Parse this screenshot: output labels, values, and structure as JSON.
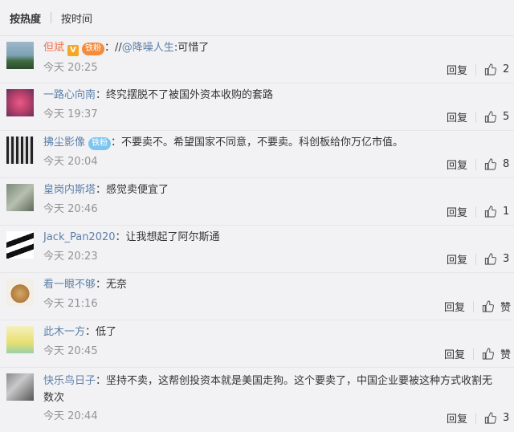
{
  "sort": {
    "hot": "按热度",
    "time": "按时间"
  },
  "comments": [
    {
      "user": "但斌",
      "v_badge": "V",
      "fan_badge": "铁粉",
      "fan_color": "orange",
      "text": "//@降噪人生:可惜了",
      "time": "今天 20:25",
      "reply": "回复",
      "likes": "2"
    },
    {
      "user": "一路心向南",
      "text": "终究摆脱不了被国外资本收购的套路",
      "time": "今天 19:37",
      "reply": "回复",
      "likes": "5"
    },
    {
      "user": "拂尘影像",
      "fan_badge": "铁粉",
      "fan_color": "blue",
      "text": "不要卖不。希望国家不同意，不要卖。科创板给你万亿市值。",
      "time": "今天 20:04",
      "reply": "回复",
      "likes": "8"
    },
    {
      "user": "皇岗内斯塔",
      "text": "感觉卖便宜了",
      "time": "今天 20:46",
      "reply": "回复",
      "likes": "1"
    },
    {
      "user": "Jack_Pan2020",
      "text": "让我想起了阿尔斯通",
      "time": "今天 20:23",
      "reply": "回复",
      "likes": "3"
    },
    {
      "user": "看一眼不够",
      "text": "无奈",
      "time": "今天 21:16",
      "reply": "回复",
      "likes": "赞"
    },
    {
      "user": "此木一方",
      "text": "低了",
      "time": "今天 20:45",
      "reply": "回复",
      "likes": "赞"
    },
    {
      "user": "快乐鸟日子",
      "text": "坚持不卖，这帮创投资本就是美国走狗。这个要卖了，中国企业要被这种方式收割无数次",
      "time": "今天 20:44",
      "reply": "回复",
      "likes": "3"
    }
  ]
}
